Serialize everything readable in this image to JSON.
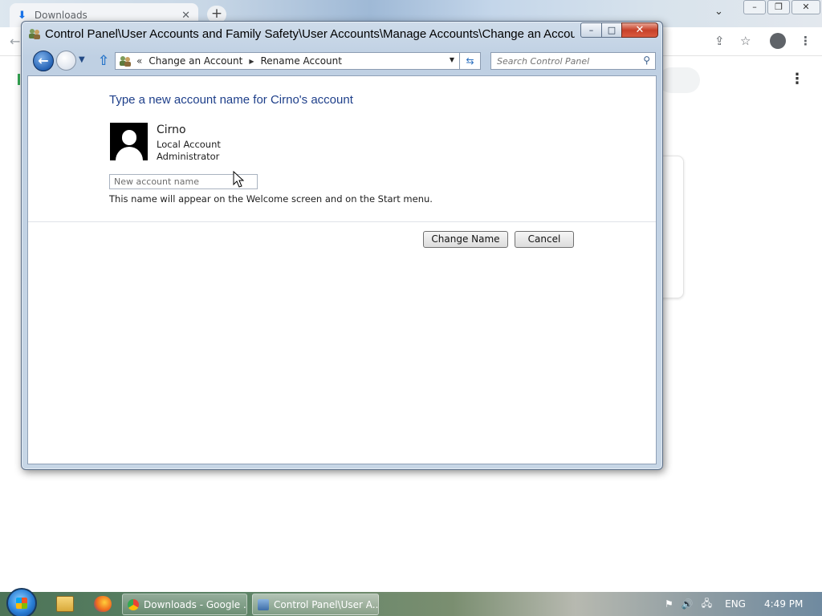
{
  "browser": {
    "tab_label": "Downloads",
    "tab_close": "✕",
    "newtab_symbol": "+",
    "download_icon": "download-icon"
  },
  "window": {
    "title": "Control Panel\\User Accounts and Family Safety\\User Accounts\\Manage Accounts\\Change an Accou...",
    "min_symbol": "–",
    "max_symbol": "□",
    "close_symbol": "✕"
  },
  "address": {
    "chevron": "«",
    "crumbs": [
      "Change an Account",
      "Rename Account"
    ],
    "separator": "▶",
    "dropdown": "▼"
  },
  "search": {
    "placeholder": "Search Control Panel"
  },
  "page": {
    "heading": "Type a new account name for Cirno's account",
    "account_name": "Cirno",
    "account_type": "Local Account",
    "account_role": "Administrator",
    "input_placeholder": "New account name",
    "input_value": "",
    "hint": "This name will appear on the Welcome screen and on the Start menu.",
    "change_button": "Change Name",
    "cancel_button": "Cancel"
  },
  "taskbar": {
    "tasks": [
      "Downloads - Google ...",
      "Control Panel\\User A..."
    ],
    "language": "ENG",
    "clock": "4:49 PM"
  },
  "colors": {
    "heading": "#1e3f8a",
    "window_frame": "#bfd0e3",
    "close_button": "#c7412a"
  }
}
